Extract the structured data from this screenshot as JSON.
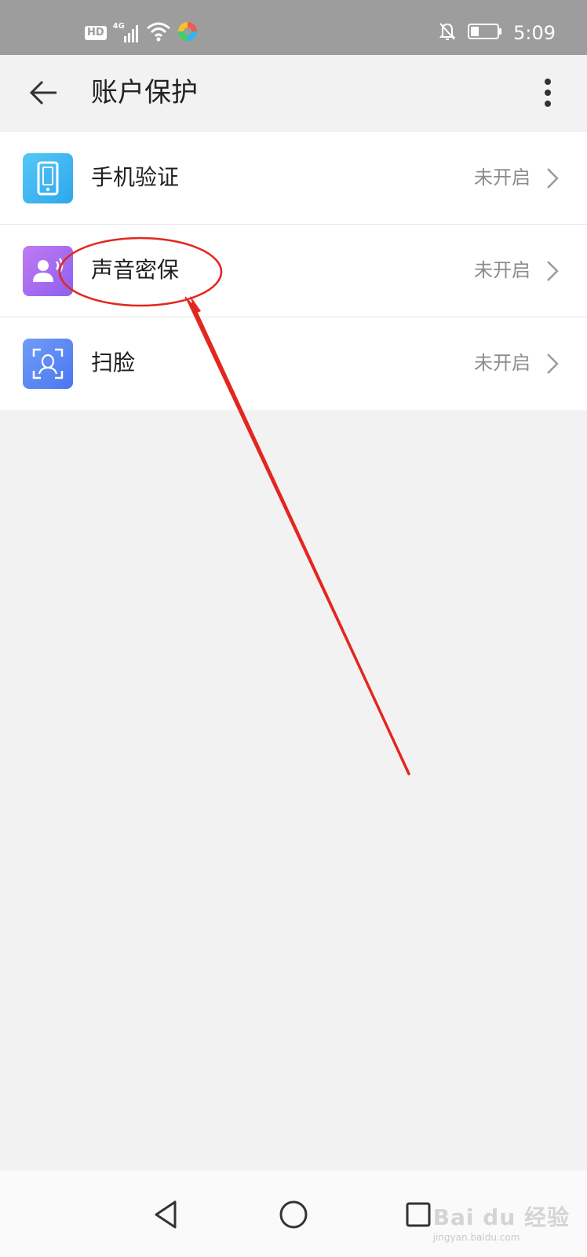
{
  "status_bar": {
    "hd_label": "HD",
    "network_label": "4G",
    "time": "5:09",
    "icons": [
      "hd-icon",
      "signal-icon",
      "wifi-icon",
      "app-icon",
      "mute-icon",
      "battery-icon"
    ]
  },
  "app_bar": {
    "title": "账户保护",
    "back_icon": "back-arrow-icon",
    "more_icon": "more-vert-icon"
  },
  "settings": [
    {
      "label": "手机验证",
      "status": "未开启",
      "icon": "phone-icon",
      "color": "#3fb7f0"
    },
    {
      "label": "声音密保",
      "status": "未开启",
      "icon": "voice-user-icon",
      "color": "#9b6ef0"
    },
    {
      "label": "扫脸",
      "status": "未开启",
      "icon": "face-scan-icon",
      "color": "#5a86f5"
    }
  ],
  "nav_bar": {
    "icons": [
      "nav-back-icon",
      "nav-home-icon",
      "nav-recents-icon"
    ]
  },
  "watermark": {
    "brand": "Bai du 经验",
    "url": "jingyan.baidu.com"
  },
  "annotation_color": "#e3261f"
}
